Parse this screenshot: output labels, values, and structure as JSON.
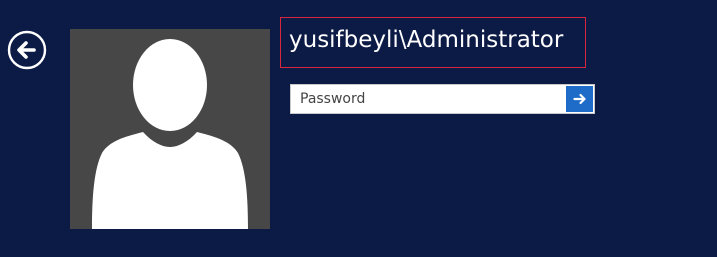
{
  "user": {
    "name": "yusifbeyli\\Administrator"
  },
  "password": {
    "placeholder": "Password",
    "value": ""
  },
  "colors": {
    "background": "#0c1a46",
    "accent": "#1f6cc8",
    "avatar_tile": "#474747",
    "highlight_frame": "#d7263d"
  },
  "icons": {
    "back": "back-arrow-icon",
    "submit": "arrow-right-icon",
    "avatar": "user-silhouette-icon"
  }
}
